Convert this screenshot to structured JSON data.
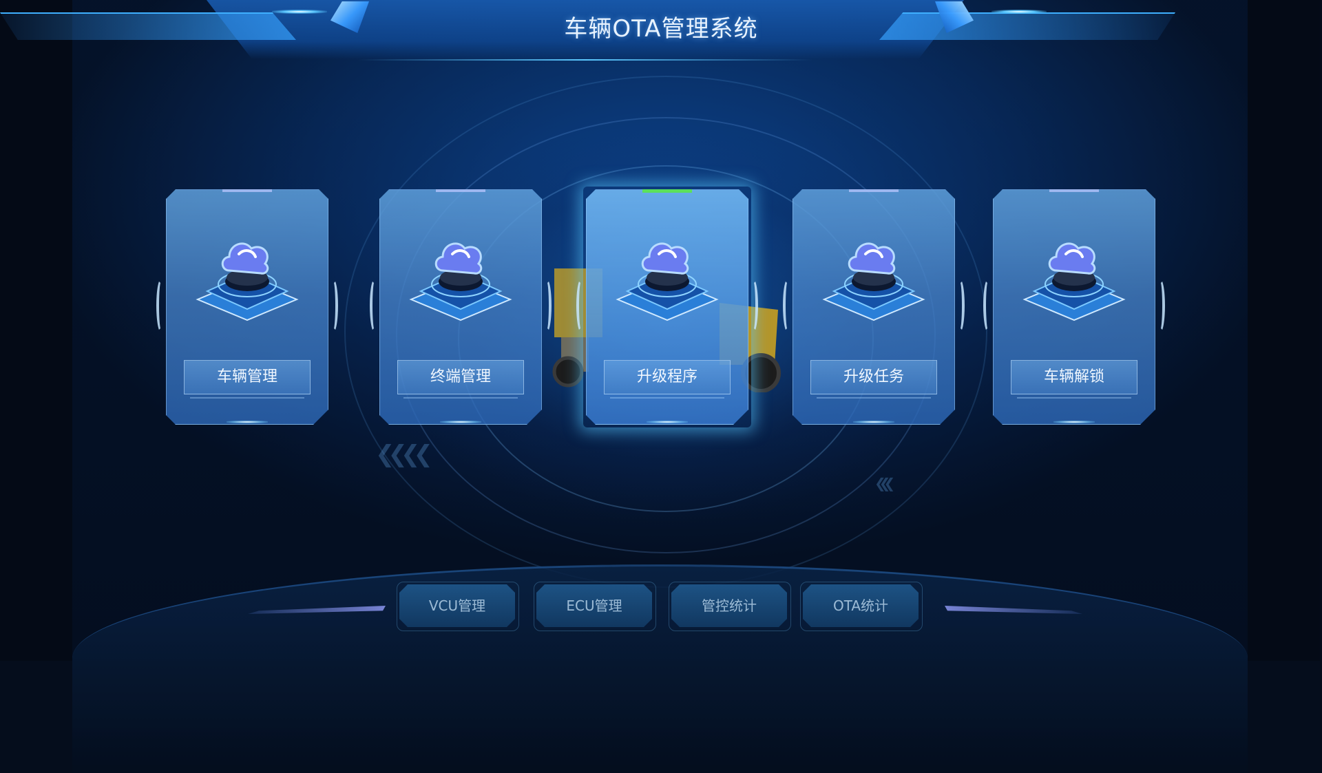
{
  "header": {
    "title": "车辆OTA管理系统"
  },
  "modules": [
    {
      "label": "车辆管理",
      "icon": "cloud-icon",
      "active": false
    },
    {
      "label": "终端管理",
      "icon": "cloud-icon",
      "active": false
    },
    {
      "label": "升级程序",
      "icon": "cloud-icon",
      "active": true
    },
    {
      "label": "升级任务",
      "icon": "cloud-icon",
      "active": false
    },
    {
      "label": "车辆解锁",
      "icon": "cloud-icon",
      "active": false
    }
  ],
  "bottom_nav": [
    {
      "label": "VCU管理"
    },
    {
      "label": "ECU管理"
    },
    {
      "label": "管控统计"
    },
    {
      "label": "OTA统计"
    }
  ],
  "colors": {
    "background": "#050d1c",
    "panel_blue": "#0f4690",
    "accent_cyan": "#5cc8ff",
    "active_marker": "#5be05b"
  }
}
